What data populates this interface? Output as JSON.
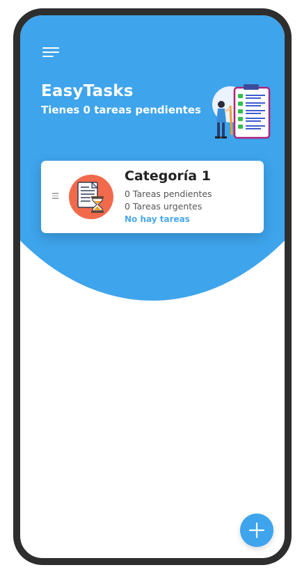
{
  "header": {
    "app_title": "EasyTasks",
    "subtitle": "Tienes 0 tareas pendientes",
    "menu_icon": "hamburger-menu-icon",
    "illustration_icon": "checklist-illustration-icon"
  },
  "categories": [
    {
      "title": "Categoría 1",
      "pending": "0 Tareas pendientes",
      "urgent": "0 Tareas urgentes",
      "status": "No hay tareas",
      "icon": "document-hourglass-icon"
    }
  ],
  "fab": {
    "icon": "plus-icon"
  },
  "colors": {
    "primary": "#3ea4ec",
    "category_icon_bg": "#f26a4b",
    "status_text": "#4aa8ee",
    "device_frame": "#2e2e2e"
  }
}
